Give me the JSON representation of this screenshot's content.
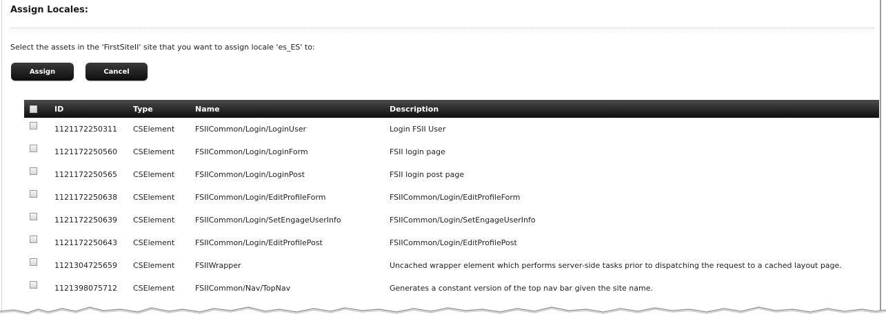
{
  "page": {
    "title": "Assign Locales:",
    "instructions": "Select the assets in the 'FirstSiteII' site that you want to assign locale 'es_ES' to:"
  },
  "buttons": {
    "assign_label": "Assign",
    "cancel_label": "Cancel"
  },
  "table": {
    "headers": {
      "id": "ID",
      "type": "Type",
      "name": "Name",
      "description": "Description"
    },
    "rows": [
      {
        "id": "1121172250311",
        "type": "CSElement",
        "name": "FSIICommon/Login/LoginUser",
        "description": "Login FSII User",
        "checked": false
      },
      {
        "id": "1121172250560",
        "type": "CSElement",
        "name": "FSIICommon/Login/LoginForm",
        "description": "FSII login page",
        "checked": false
      },
      {
        "id": "1121172250565",
        "type": "CSElement",
        "name": "FSIICommon/Login/LoginPost",
        "description": "FSII login post page",
        "checked": false
      },
      {
        "id": "1121172250638",
        "type": "CSElement",
        "name": "FSIICommon/Login/EditProfileForm",
        "description": "FSIICommon/Login/EditProfileForm",
        "checked": false
      },
      {
        "id": "1121172250639",
        "type": "CSElement",
        "name": "FSIICommon/Login/SetEngageUserInfo",
        "description": "FSIICommon/Login/SetEngageUserInfo",
        "checked": false
      },
      {
        "id": "1121172250643",
        "type": "CSElement",
        "name": "FSIICommon/Login/EditProfilePost",
        "description": "FSIICommon/Login/EditProfilePost",
        "checked": false
      },
      {
        "id": "1121304725659",
        "type": "CSElement",
        "name": "FSIIWrapper",
        "description": "Uncached wrapper element which performs server-side tasks prior to dispatching the request to a cached layout page.",
        "checked": false
      },
      {
        "id": "1121398075712",
        "type": "CSElement",
        "name": "FSIICommon/Nav/TopNav",
        "description": "Generates a constant version of the top nav bar given the site name.",
        "checked": false
      }
    ]
  }
}
